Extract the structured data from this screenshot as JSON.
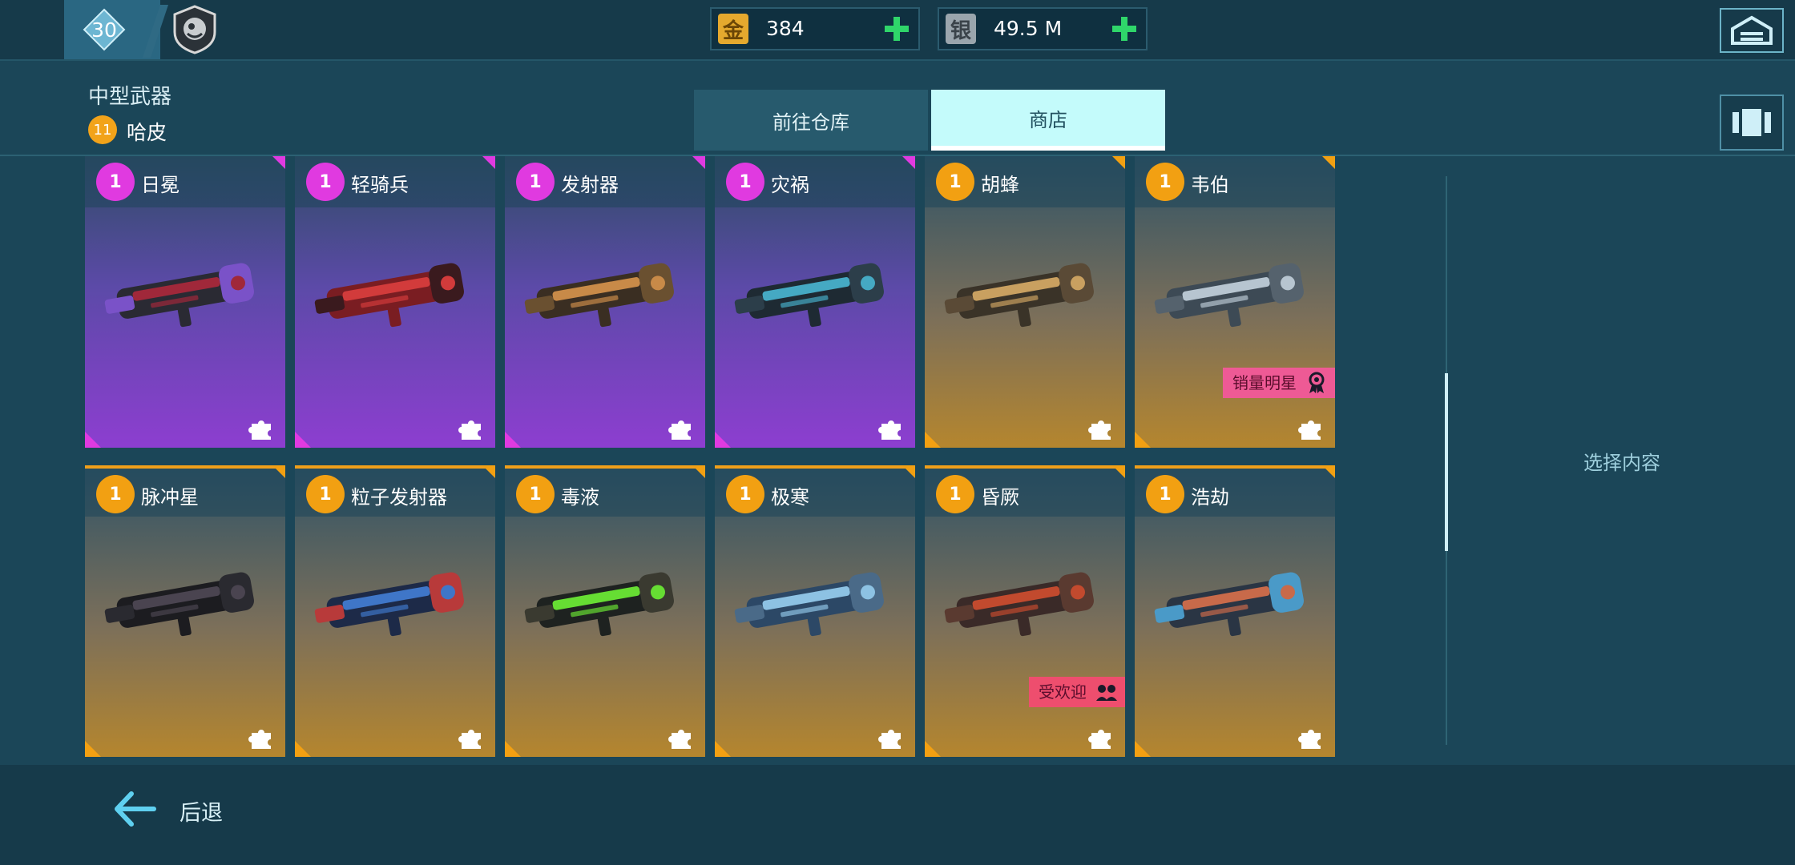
{
  "topbar": {
    "level": "30",
    "gold": {
      "icon_char": "金",
      "value": "384",
      "icon": "gold-currency-icon"
    },
    "silver": {
      "icon_char": "银",
      "value": "49.5 M",
      "icon": "silver-currency-icon"
    }
  },
  "header": {
    "category": "中型武器",
    "pilot": {
      "level": "11",
      "name": "哈皮"
    },
    "tabs": {
      "warehouse": "前往仓库",
      "shop": "商店"
    }
  },
  "cards": [
    {
      "name": "日冕",
      "level": "1",
      "rarity": "epic",
      "colors": [
        "#2a2a33",
        "#a0283a",
        "#7a52c8"
      ]
    },
    {
      "name": "轻骑兵",
      "level": "1",
      "rarity": "epic",
      "colors": [
        "#7a1d22",
        "#d23b3b",
        "#3a1a1e"
      ]
    },
    {
      "name": "发射器",
      "level": "1",
      "rarity": "epic",
      "colors": [
        "#3a2e22",
        "#c88a48",
        "#6a5030"
      ]
    },
    {
      "name": "灾祸",
      "level": "1",
      "rarity": "epic",
      "colors": [
        "#1e2a33",
        "#45a9c3",
        "#2c3e4a"
      ]
    },
    {
      "name": "胡蜂",
      "level": "1",
      "rarity": "legendary",
      "colors": [
        "#3a3328",
        "#c9a060",
        "#5a4a36"
      ]
    },
    {
      "name": "韦伯",
      "level": "1",
      "rarity": "legendary",
      "colors": [
        "#3d4a55",
        "#b7c5d0",
        "#55626d"
      ],
      "tag": {
        "text": "销量明星",
        "type": "star"
      }
    },
    {
      "name": "脉冲星",
      "level": "1",
      "rarity": "legendary",
      "colors": [
        "#1c1c20",
        "#4a4450",
        "#2a2a30"
      ]
    },
    {
      "name": "粒子发射器",
      "level": "1",
      "rarity": "legendary",
      "colors": [
        "#1d2a48",
        "#3f76c8",
        "#b83a3a"
      ]
    },
    {
      "name": "毒液",
      "level": "1",
      "rarity": "legendary",
      "colors": [
        "#1e2220",
        "#66dd33",
        "#3a3a30"
      ]
    },
    {
      "name": "极寒",
      "level": "1",
      "rarity": "legendary",
      "colors": [
        "#2c4866",
        "#8dc2e3",
        "#4a6a88"
      ]
    },
    {
      "name": "昏厥",
      "level": "1",
      "rarity": "legendary",
      "colors": [
        "#3a2a28",
        "#c24a2e",
        "#5a3a30"
      ],
      "tag": {
        "text": "受欢迎",
        "type": "pop"
      }
    },
    {
      "name": "浩劫",
      "level": "1",
      "rarity": "legendary",
      "colors": [
        "#2a3544",
        "#c86a4a",
        "#4a9ac8"
      ]
    }
  ],
  "panel": {
    "placeholder": "选择内容"
  },
  "footer": {
    "back": "后退"
  },
  "colors": {
    "epic": "#e03ae0",
    "legendary": "#f2a012",
    "accent": "#c4fbfb"
  }
}
